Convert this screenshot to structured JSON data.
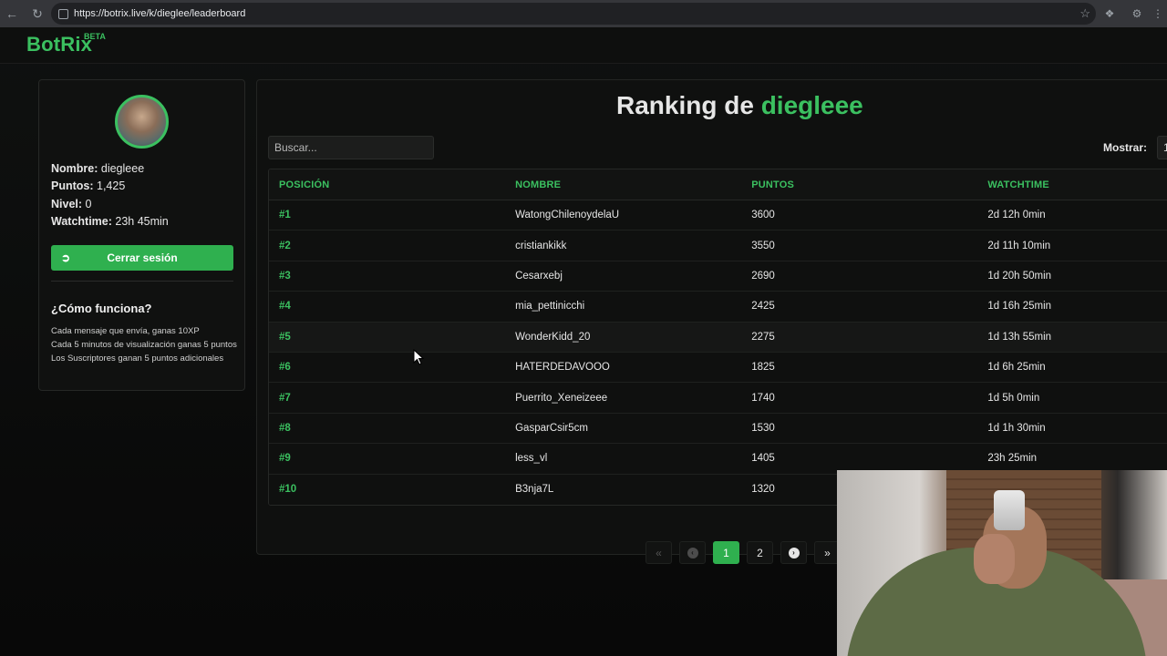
{
  "browser": {
    "url": "https://botrix.live/k/dieglee/leaderboard",
    "back_icon": "arrow-left-icon",
    "forward_icon": "arrow-right-icon",
    "reload_icon": "reload-icon"
  },
  "site": {
    "logo": "BotRix",
    "beta": "BETA"
  },
  "profile": {
    "nombre_label": "Nombre:",
    "nombre_value": " diegleee",
    "puntos_label": "Puntos:",
    "puntos_value": " 1,425",
    "nivel_label": "Nivel:",
    "nivel_value": " 0",
    "watchtime_label": "Watchtime:",
    "watchtime_value": " 23h 45min",
    "logout_label": "Cerrar sesión",
    "how_title": "¿Cómo funciona?",
    "how_lines": [
      "Cada mensaje que envía, ganas 10XP",
      "Cada 5 minutos de visualización ganas 5 puntos",
      "Los Suscriptores ganan 5 puntos adicionales"
    ]
  },
  "ranking": {
    "title_prefix": "Ranking de ",
    "title_user": "diegleee",
    "search_placeholder": "Buscar...",
    "mostrar_label": "Mostrar:",
    "mostrar_value": "1",
    "columns": [
      "POSICIÓN",
      "NOMBRE",
      "PUNTOS",
      "WATCHTIME"
    ],
    "rows": [
      {
        "pos": "#1",
        "name": "WatongChilenoydelaU",
        "points": "3600",
        "watchtime": "2d 12h 0min"
      },
      {
        "pos": "#2",
        "name": "cristiankikk",
        "points": "3550",
        "watchtime": "2d 11h 10min"
      },
      {
        "pos": "#3",
        "name": "Cesarxebj",
        "points": "2690",
        "watchtime": "1d 20h 50min"
      },
      {
        "pos": "#4",
        "name": "mia_pettinicchi",
        "points": "2425",
        "watchtime": "1d 16h 25min"
      },
      {
        "pos": "#5",
        "name": "WonderKidd_20",
        "points": "2275",
        "watchtime": "1d 13h 55min"
      },
      {
        "pos": "#6",
        "name": "HATERDEDAVOOO",
        "points": "1825",
        "watchtime": "1d 6h 25min"
      },
      {
        "pos": "#7",
        "name": "Puerrito_Xeneizeee",
        "points": "1740",
        "watchtime": "1d 5h 0min"
      },
      {
        "pos": "#8",
        "name": "GasparCsir5cm",
        "points": "1530",
        "watchtime": "1d 1h 30min"
      },
      {
        "pos": "#9",
        "name": "less_vl",
        "points": "1405",
        "watchtime": "23h 25min"
      },
      {
        "pos": "#10",
        "name": "B3nja7L",
        "points": "1320",
        "watchtime": ""
      }
    ],
    "pagination": {
      "first": "«",
      "prev": "‹",
      "pages": [
        "1",
        "2"
      ],
      "next": "›",
      "last": "»"
    }
  },
  "colors": {
    "accent": "#3bc060",
    "button": "#2fb04f",
    "background": "#0f100f"
  }
}
